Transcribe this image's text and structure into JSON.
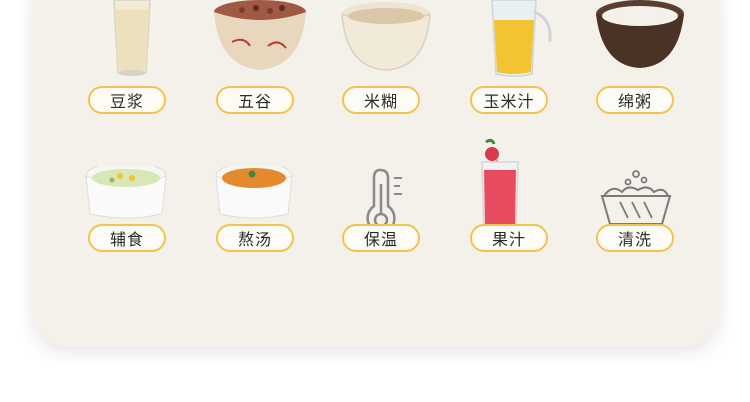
{
  "functions": [
    {
      "label": "豆浆",
      "icon": "soy-milk-glass-icon"
    },
    {
      "label": "五谷",
      "icon": "grain-porridge-bowl-icon"
    },
    {
      "label": "米糊",
      "icon": "rice-paste-bowl-icon"
    },
    {
      "label": "玉米汁",
      "icon": "corn-juice-pitcher-icon"
    },
    {
      "label": "绵粥",
      "icon": "congee-bowl-icon"
    },
    {
      "label": "辅食",
      "icon": "baby-food-ramekin-icon"
    },
    {
      "label": "熬汤",
      "icon": "soup-ramekin-icon"
    },
    {
      "label": "保温",
      "icon": "thermometer-icon"
    },
    {
      "label": "果汁",
      "icon": "fruit-juice-glass-icon"
    },
    {
      "label": "清洗",
      "icon": "wash-basin-icon"
    }
  ],
  "colors": {
    "accent": "#f2c44f",
    "card_bg": "#f4f0ea",
    "text": "#2b2b2b"
  }
}
